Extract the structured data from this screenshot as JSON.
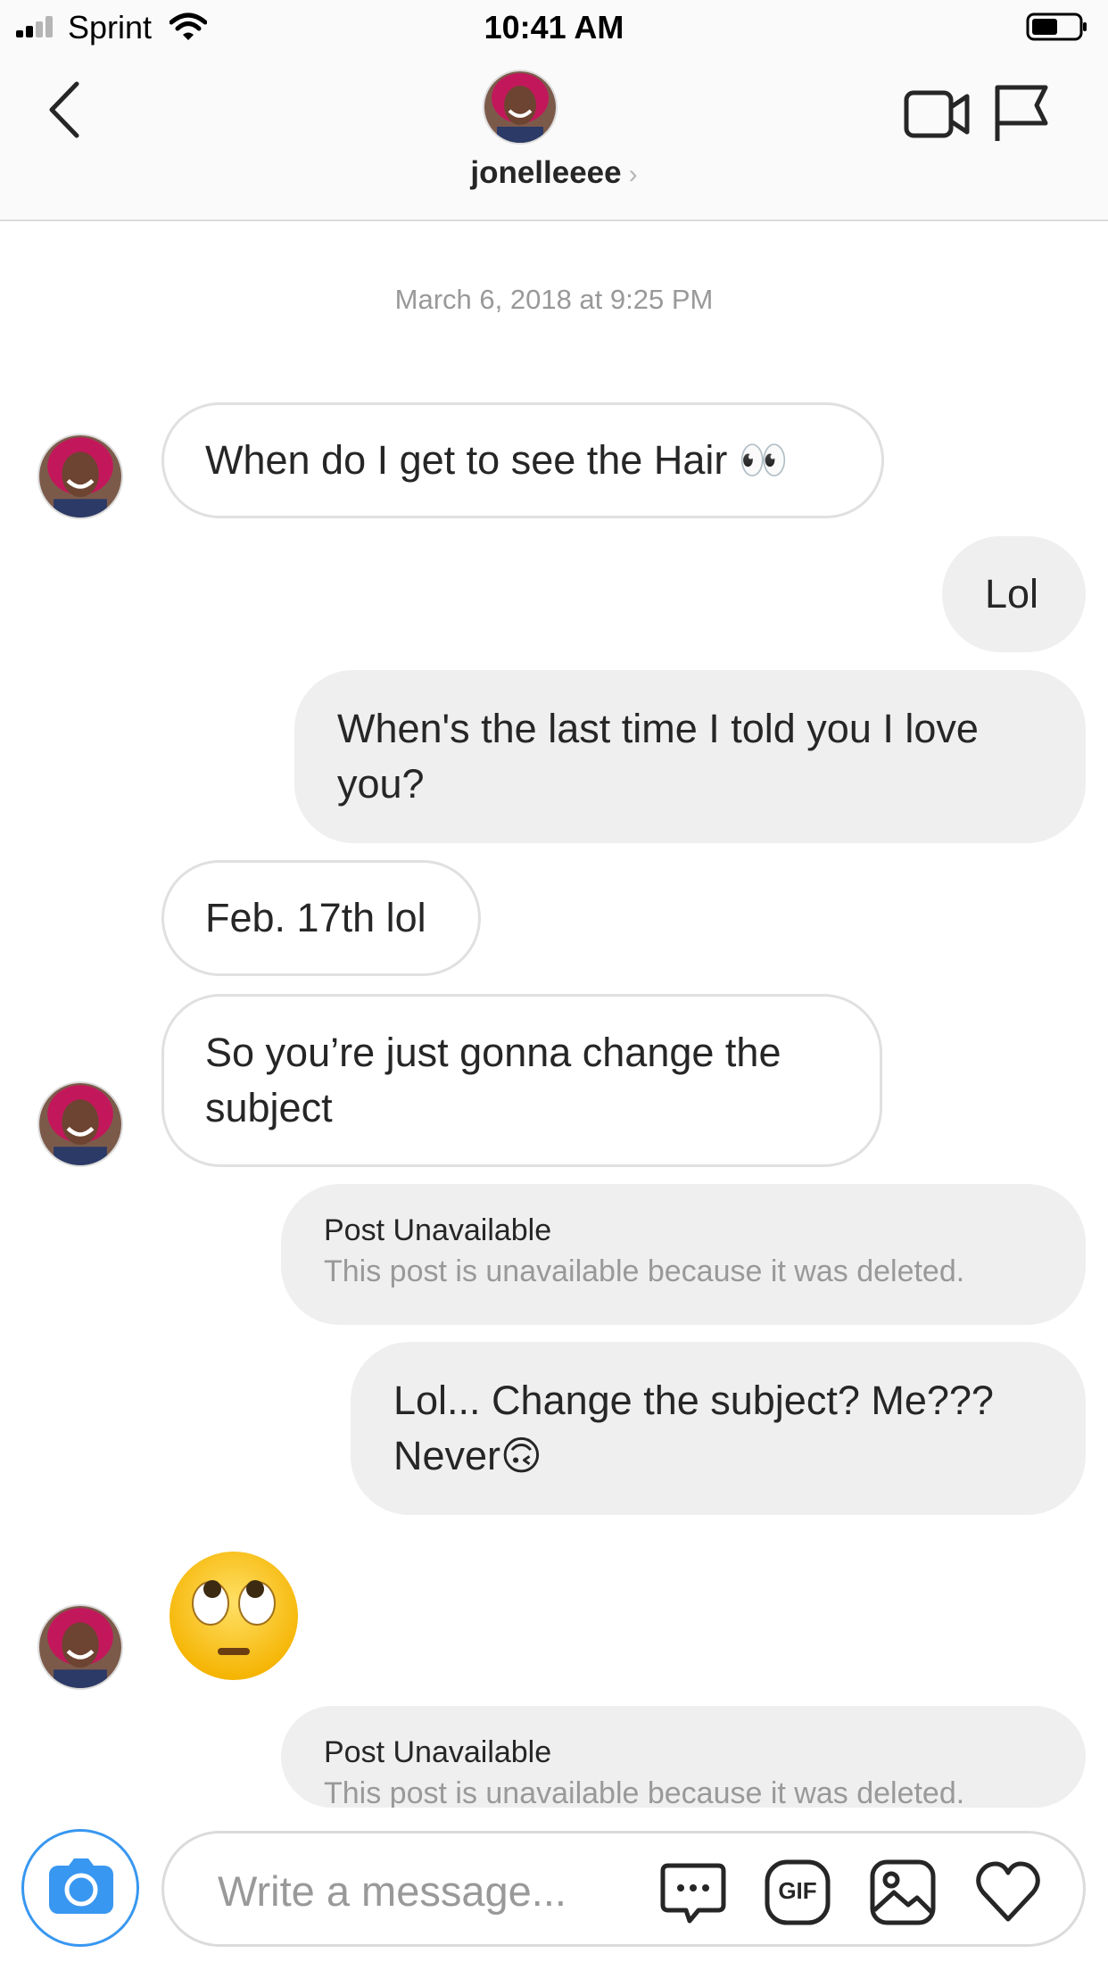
{
  "status_bar": {
    "carrier": "Sprint",
    "time": "10:41 AM",
    "signal_bars_active": 2,
    "battery_level": 0.55
  },
  "header": {
    "username": "jonelleeee",
    "chevron": "›",
    "icons": [
      "back-chevron-icon",
      "video-call-icon",
      "flag-icon"
    ]
  },
  "conversation": {
    "timestamp": "March 6, 2018 at 9:25 PM",
    "messages": [
      {
        "direction": "incoming",
        "text": "When do I get to see the Hair 👀"
      },
      {
        "direction": "outgoing",
        "text": "Lol"
      },
      {
        "direction": "outgoing",
        "text": "When's the last time I told you I love you?"
      },
      {
        "direction": "incoming",
        "text": "Feb. 17th lol"
      },
      {
        "direction": "incoming",
        "text": "So you’re just gonna change the subject"
      },
      {
        "direction": "outgoing",
        "type": "post",
        "title": "Post Unavailable",
        "subtitle": "This post is unavailable because it was deleted."
      },
      {
        "direction": "outgoing",
        "text": "Lol... Change the subject? Me??? Never🙃"
      },
      {
        "direction": "incoming",
        "type": "emoji",
        "text": "🙄"
      },
      {
        "direction": "outgoing",
        "type": "post",
        "title": "Post Unavailable",
        "subtitle": "This post is unavailable because it was deleted."
      }
    ]
  },
  "composer": {
    "placeholder": "Write a message...",
    "gif_label": "GIF",
    "icons": [
      "camera-icon",
      "chat-bubble-icon",
      "gif-icon",
      "photo-icon",
      "heart-icon"
    ],
    "accent_color": "#3897f0"
  }
}
